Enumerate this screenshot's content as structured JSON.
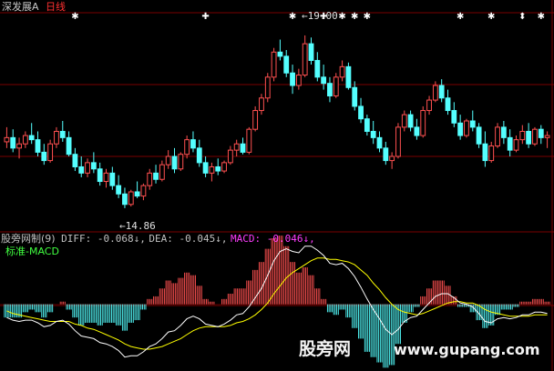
{
  "header": {
    "stock_name": "深发展A",
    "period": "日线"
  },
  "price_panel": {
    "high_label": "19.00",
    "low_label": "14.86",
    "high_marker": "←",
    "low_marker": "←"
  },
  "indicator_panel": {
    "title": "股旁网制(9)",
    "diff_label": "DIFF:",
    "diff_value": "-0.068",
    "diff_arrow": "↓",
    "dea_label": "DEA:",
    "dea_value": "-0.045",
    "dea_arrow": "↓",
    "macd_label": "MACD:",
    "macd_value": "-0.046",
    "macd_arrow": "↓",
    "sublabel": "标准-MACD"
  },
  "watermark": {
    "cn": "股旁网",
    "url": "www.gupang.com"
  },
  "colors": {
    "background": "#000000",
    "up_candle": "#ff5050",
    "down_candle": "#54ffff",
    "grid_red": "#7a0000",
    "diff_line": "#ffffff",
    "dea_line": "#ffff00",
    "macd_text": "#ff3cff",
    "label_text": "#c0c0c0",
    "title_red": "#ff3030"
  },
  "chart_data": {
    "type": "candlestick",
    "price_ylim": [
      14.4,
      19.5
    ],
    "price_high": 19.0,
    "price_low": 14.86,
    "candles": [
      [
        16.45,
        16.8,
        16.3,
        16.55
      ],
      [
        16.55,
        16.75,
        16.2,
        16.3
      ],
      [
        16.3,
        16.55,
        16.05,
        16.4
      ],
      [
        16.4,
        16.7,
        16.3,
        16.6
      ],
      [
        16.6,
        16.9,
        16.4,
        16.5
      ],
      [
        16.5,
        16.7,
        16.1,
        16.2
      ],
      [
        16.2,
        16.4,
        15.9,
        16.0
      ],
      [
        16.0,
        16.5,
        15.95,
        16.4
      ],
      [
        16.4,
        16.8,
        16.3,
        16.7
      ],
      [
        16.7,
        16.95,
        16.45,
        16.55
      ],
      [
        16.55,
        16.7,
        16.1,
        16.15
      ],
      [
        16.15,
        16.3,
        15.75,
        15.85
      ],
      [
        15.85,
        16.1,
        15.6,
        15.7
      ],
      [
        15.7,
        16.05,
        15.6,
        15.95
      ],
      [
        15.95,
        16.2,
        15.7,
        15.8
      ],
      [
        15.8,
        15.95,
        15.4,
        15.5
      ],
      [
        15.5,
        15.8,
        15.35,
        15.7
      ],
      [
        15.7,
        15.85,
        15.3,
        15.4
      ],
      [
        15.4,
        15.65,
        15.1,
        15.2
      ],
      [
        15.2,
        15.35,
        14.86,
        14.95
      ],
      [
        14.95,
        15.3,
        14.9,
        15.25
      ],
      [
        15.25,
        15.5,
        15.1,
        15.15
      ],
      [
        15.15,
        15.45,
        15.05,
        15.4
      ],
      [
        15.4,
        15.8,
        15.3,
        15.7
      ],
      [
        15.7,
        15.9,
        15.45,
        15.55
      ],
      [
        15.55,
        16.0,
        15.5,
        15.9
      ],
      [
        15.9,
        16.25,
        15.8,
        16.1
      ],
      [
        16.1,
        16.3,
        15.7,
        15.8
      ],
      [
        15.8,
        16.2,
        15.75,
        16.15
      ],
      [
        16.15,
        16.6,
        16.05,
        16.5
      ],
      [
        16.5,
        16.7,
        16.2,
        16.3
      ],
      [
        16.3,
        16.5,
        15.85,
        15.95
      ],
      [
        15.95,
        16.1,
        15.6,
        15.7
      ],
      [
        15.7,
        15.95,
        15.5,
        15.85
      ],
      [
        15.85,
        16.05,
        15.65,
        15.75
      ],
      [
        15.75,
        16.0,
        15.7,
        15.95
      ],
      [
        15.95,
        16.35,
        15.9,
        16.25
      ],
      [
        16.25,
        16.5,
        16.1,
        16.4
      ],
      [
        16.4,
        16.55,
        16.15,
        16.2
      ],
      [
        16.2,
        16.8,
        16.15,
        16.75
      ],
      [
        16.75,
        17.3,
        16.7,
        17.2
      ],
      [
        17.2,
        17.6,
        17.1,
        17.5
      ],
      [
        17.5,
        18.1,
        17.4,
        18.0
      ],
      [
        18.0,
        18.7,
        17.9,
        18.6
      ],
      [
        18.6,
        18.9,
        18.4,
        18.5
      ],
      [
        18.5,
        18.65,
        18.0,
        18.1
      ],
      [
        18.1,
        18.3,
        17.6,
        17.8
      ],
      [
        17.8,
        18.2,
        17.7,
        18.05
      ],
      [
        18.05,
        19.0,
        18.0,
        18.8
      ],
      [
        18.8,
        18.95,
        18.3,
        18.4
      ],
      [
        18.4,
        18.6,
        17.9,
        18.0
      ],
      [
        18.0,
        18.3,
        17.7,
        17.85
      ],
      [
        17.85,
        18.0,
        17.4,
        17.55
      ],
      [
        17.55,
        18.1,
        17.5,
        18.0
      ],
      [
        18.0,
        18.4,
        17.9,
        18.25
      ],
      [
        18.25,
        18.35,
        17.7,
        17.75
      ],
      [
        17.75,
        17.9,
        17.2,
        17.3
      ],
      [
        17.3,
        17.5,
        16.9,
        17.0
      ],
      [
        17.0,
        17.1,
        16.6,
        16.7
      ],
      [
        16.7,
        16.95,
        16.4,
        16.55
      ],
      [
        16.55,
        16.7,
        16.2,
        16.3
      ],
      [
        16.3,
        16.45,
        15.9,
        16.0
      ],
      [
        16.0,
        16.2,
        15.8,
        16.1
      ],
      [
        16.1,
        16.9,
        16.05,
        16.8
      ],
      [
        16.8,
        17.2,
        16.7,
        17.1
      ],
      [
        17.1,
        17.2,
        16.7,
        16.8
      ],
      [
        16.8,
        17.0,
        16.5,
        16.6
      ],
      [
        16.6,
        17.3,
        16.55,
        17.2
      ],
      [
        17.2,
        17.55,
        17.1,
        17.45
      ],
      [
        17.45,
        17.9,
        17.4,
        17.8
      ],
      [
        17.8,
        17.95,
        17.4,
        17.5
      ],
      [
        17.5,
        17.7,
        17.1,
        17.2
      ],
      [
        17.2,
        17.4,
        16.8,
        16.9
      ],
      [
        16.9,
        17.1,
        16.5,
        16.6
      ],
      [
        16.6,
        17.0,
        16.55,
        16.95
      ],
      [
        16.95,
        17.2,
        16.7,
        16.8
      ],
      [
        16.8,
        16.9,
        16.3,
        16.4
      ],
      [
        16.4,
        16.7,
        15.85,
        16.0
      ],
      [
        16.0,
        16.45,
        15.95,
        16.35
      ],
      [
        16.35,
        16.9,
        16.3,
        16.8
      ],
      [
        16.8,
        16.95,
        16.4,
        16.55
      ],
      [
        16.55,
        16.75,
        16.1,
        16.25
      ],
      [
        16.25,
        16.6,
        16.2,
        16.5
      ],
      [
        16.5,
        16.85,
        16.4,
        16.7
      ],
      [
        16.7,
        16.9,
        16.3,
        16.4
      ],
      [
        16.4,
        16.8,
        16.35,
        16.75
      ],
      [
        16.75,
        16.85,
        16.4,
        16.55
      ],
      [
        16.55,
        16.7,
        16.3,
        16.6
      ]
    ],
    "diff": [
      -0.1,
      -0.12,
      -0.13,
      -0.12,
      -0.12,
      -0.14,
      -0.17,
      -0.16,
      -0.13,
      -0.12,
      -0.15,
      -0.2,
      -0.24,
      -0.25,
      -0.26,
      -0.29,
      -0.3,
      -0.32,
      -0.35,
      -0.4,
      -0.39,
      -0.39,
      -0.36,
      -0.32,
      -0.3,
      -0.26,
      -0.21,
      -0.2,
      -0.16,
      -0.11,
      -0.09,
      -0.11,
      -0.15,
      -0.16,
      -0.17,
      -0.15,
      -0.12,
      -0.08,
      -0.07,
      -0.02,
      0.05,
      0.12,
      0.22,
      0.33,
      0.4,
      0.42,
      0.4,
      0.39,
      0.44,
      0.44,
      0.41,
      0.37,
      0.31,
      0.3,
      0.31,
      0.27,
      0.21,
      0.13,
      0.04,
      -0.04,
      -0.11,
      -0.19,
      -0.23,
      -0.19,
      -0.13,
      -0.1,
      -0.09,
      -0.04,
      0.01,
      0.06,
      0.08,
      0.08,
      0.05,
      0.01,
      0.0,
      -0.02,
      -0.07,
      -0.13,
      -0.14,
      -0.11,
      -0.1,
      -0.11,
      -0.1,
      -0.08,
      -0.08,
      -0.06,
      -0.06,
      -0.07
    ],
    "dea": [
      -0.05,
      -0.07,
      -0.08,
      -0.09,
      -0.1,
      -0.11,
      -0.12,
      -0.13,
      -0.13,
      -0.13,
      -0.13,
      -0.15,
      -0.16,
      -0.18,
      -0.19,
      -0.21,
      -0.23,
      -0.25,
      -0.27,
      -0.3,
      -0.32,
      -0.33,
      -0.34,
      -0.34,
      -0.33,
      -0.32,
      -0.3,
      -0.28,
      -0.26,
      -0.23,
      -0.2,
      -0.18,
      -0.17,
      -0.17,
      -0.17,
      -0.17,
      -0.16,
      -0.14,
      -0.13,
      -0.11,
      -0.08,
      -0.04,
      0.01,
      0.08,
      0.14,
      0.2,
      0.24,
      0.27,
      0.3,
      0.33,
      0.35,
      0.35,
      0.34,
      0.34,
      0.33,
      0.32,
      0.3,
      0.26,
      0.22,
      0.16,
      0.11,
      0.05,
      0.0,
      -0.04,
      -0.06,
      -0.07,
      -0.08,
      -0.07,
      -0.05,
      -0.03,
      -0.01,
      0.01,
      0.02,
      0.02,
      0.01,
      0.01,
      -0.01,
      -0.04,
      -0.06,
      -0.07,
      -0.08,
      -0.09,
      -0.09,
      -0.09,
      -0.09,
      -0.08,
      -0.08,
      -0.08
    ],
    "macd_ylim": [
      -0.45,
      0.5
    ],
    "signal_markers": [
      {
        "index": 11,
        "glyph": "✱"
      },
      {
        "index": 32,
        "glyph": "✚"
      },
      {
        "index": 46,
        "glyph": "✱"
      },
      {
        "index": 51,
        "glyph": "✚"
      },
      {
        "index": 54,
        "glyph": "✱"
      },
      {
        "index": 56,
        "glyph": "✱"
      },
      {
        "index": 58,
        "glyph": "✱"
      },
      {
        "index": 73,
        "glyph": "✱"
      },
      {
        "index": 78,
        "glyph": "✱"
      },
      {
        "index": 83,
        "glyph": "⬍"
      },
      {
        "index": 86,
        "glyph": "✱"
      }
    ]
  }
}
